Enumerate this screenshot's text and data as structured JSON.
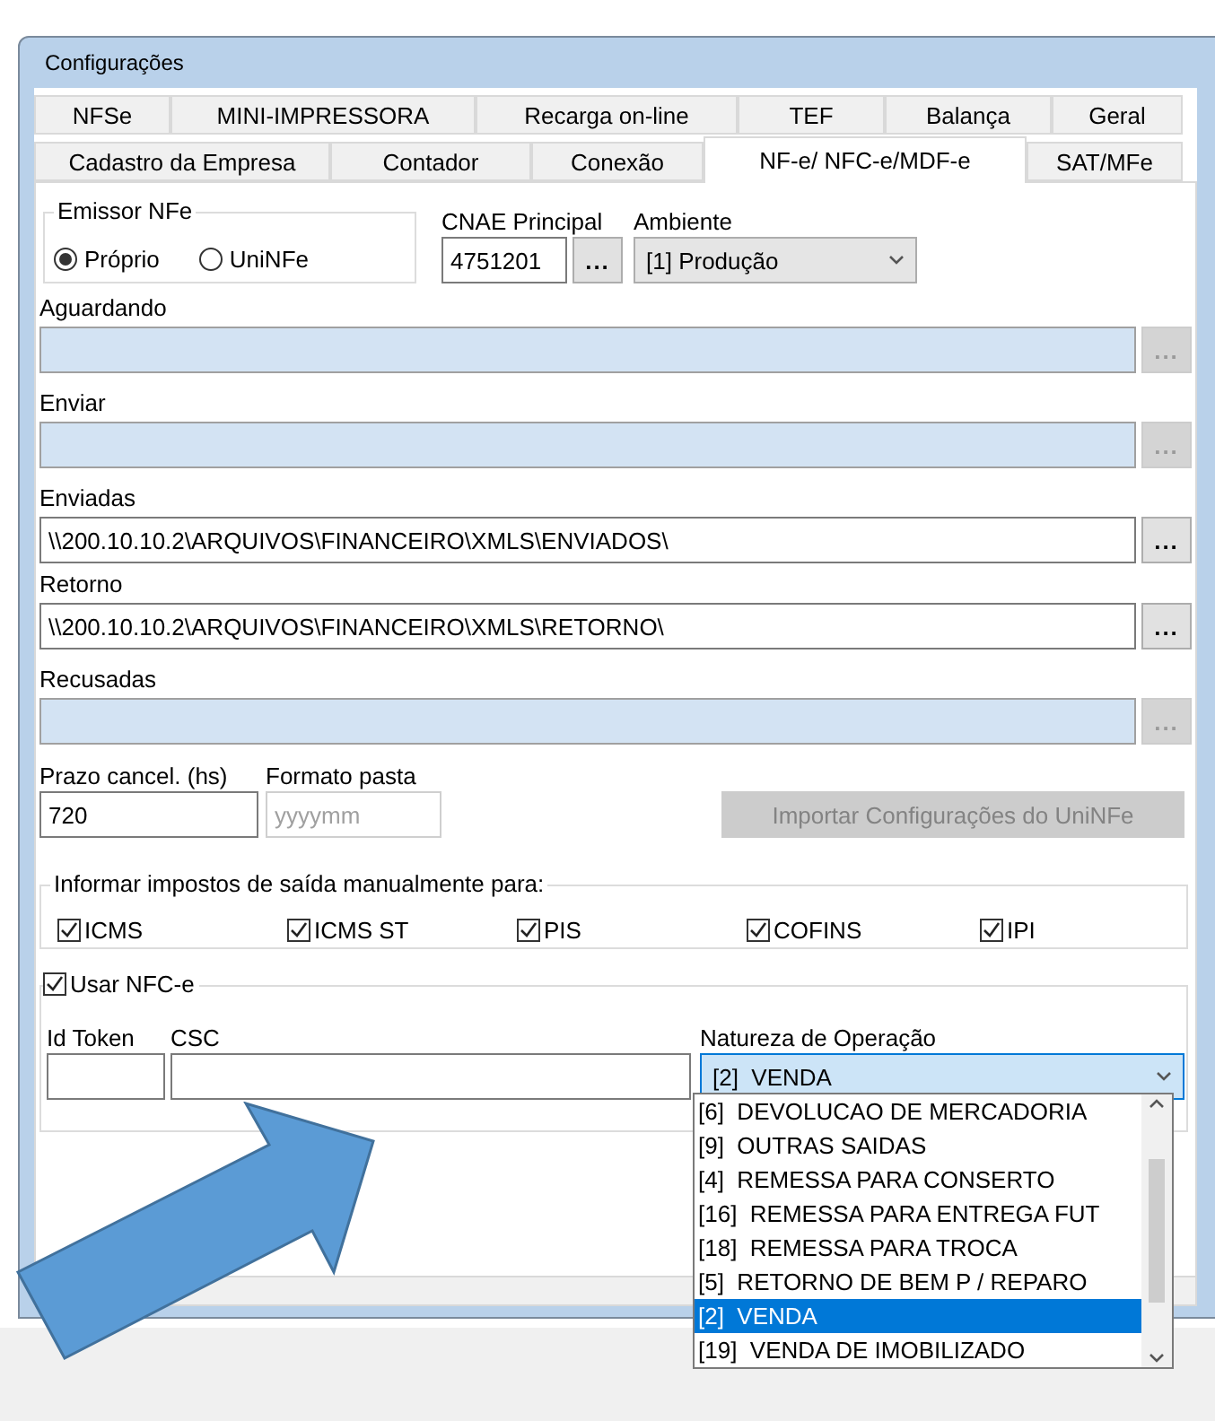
{
  "window": {
    "title": "Configurações"
  },
  "tabs_row_1": [
    {
      "label": "NFSe",
      "selected": false
    },
    {
      "label": "MINI-IMPRESSORA",
      "selected": false
    },
    {
      "label": "Recarga on-line",
      "selected": false
    },
    {
      "label": "TEF",
      "selected": false
    },
    {
      "label": "Balança",
      "selected": false
    },
    {
      "label": "Geral",
      "selected": false
    }
  ],
  "tabs_row_2": [
    {
      "label": "Cadastro da Empresa",
      "selected": false
    },
    {
      "label": "Contador",
      "selected": false
    },
    {
      "label": "Conexão",
      "selected": false
    },
    {
      "label": "NF-e/ NFC-e/MDF-e",
      "selected": true
    },
    {
      "label": "SAT/MFe",
      "selected": false
    }
  ],
  "emissor": {
    "legend": "Emissor NFe",
    "options": [
      {
        "label": "Próprio",
        "selected": true
      },
      {
        "label": "UniNFe",
        "selected": false
      }
    ]
  },
  "cnae": {
    "label": "CNAE Principal",
    "value": "4751201",
    "button": "..."
  },
  "ambiente": {
    "label": "Ambiente",
    "value": "[1] Produção"
  },
  "folders": [
    {
      "label": "Aguardando",
      "disabled": true,
      "button": "..."
    },
    {
      "label": "Enviar",
      "disabled": true,
      "button": "..."
    },
    {
      "label": "Enviadas",
      "value": "\\\\200.10.10.2\\ARQUIVOS\\FINANCEIRO\\XMLS\\ENVIADOS\\",
      "disabled": false,
      "button": "..."
    },
    {
      "label": "Retorno",
      "value": "\\\\200.10.10.2\\ARQUIVOS\\FINANCEIRO\\XMLS\\RETORNO\\",
      "disabled": false,
      "button": "..."
    },
    {
      "label": "Recusadas",
      "disabled": true,
      "button": "..."
    }
  ],
  "prazo": {
    "label": "Prazo cancel. (hs)",
    "value": "720"
  },
  "formato": {
    "label": "Formato pasta",
    "placeholder": "yyyymm"
  },
  "import_button": {
    "label": "Importar Configurações do UniNFe",
    "disabled": true
  },
  "impostos": {
    "legend": "Informar impostos de saída manualmente para:",
    "items": [
      {
        "label": "ICMS",
        "checked": true
      },
      {
        "label": "ICMS ST",
        "checked": true
      },
      {
        "label": "PIS",
        "checked": true
      },
      {
        "label": "COFINS",
        "checked": true
      },
      {
        "label": "IPI",
        "checked": true
      }
    ]
  },
  "nfce": {
    "label": "Usar NFC-e",
    "checked": true,
    "id_token": {
      "label": "Id Token"
    },
    "csc": {
      "label": "CSC"
    },
    "natureza": {
      "label": "Natureza de Operação",
      "value": "[2]  VENDA",
      "options": [
        {
          "label": "[6]  DEVOLUCAO DE MERCADORIA",
          "selected": false
        },
        {
          "label": "[9]  OUTRAS SAIDAS",
          "selected": false
        },
        {
          "label": "[4]  REMESSA PARA CONSERTO",
          "selected": false
        },
        {
          "label": "[16]  REMESSA PARA ENTREGA FUT",
          "selected": false
        },
        {
          "label": "[18]  REMESSA PARA TROCA",
          "selected": false
        },
        {
          "label": "[5]  RETORNO DE BEM P / REPARO",
          "selected": false
        },
        {
          "label": "[2]  VENDA",
          "selected": true
        },
        {
          "label": "[19]  VENDA DE IMOBILIZADO",
          "selected": false
        }
      ]
    }
  }
}
